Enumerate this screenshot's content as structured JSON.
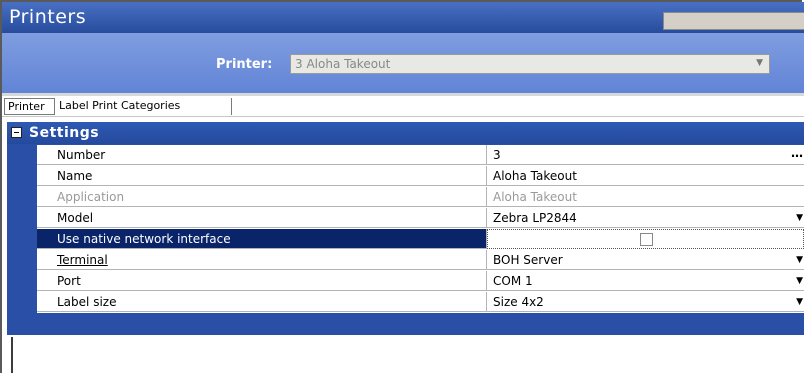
{
  "window": {
    "title": "Printers"
  },
  "selector": {
    "label": "Printer:",
    "value": "3  Aloha Takeout"
  },
  "tabs": [
    {
      "label": "Printer",
      "active": true
    },
    {
      "label": "Label Print Categories",
      "active": false
    }
  ],
  "section": {
    "title": "Settings",
    "expanded": true
  },
  "properties": [
    {
      "name": "Number",
      "value": "3",
      "editor": "ellipsis"
    },
    {
      "name": "Name",
      "value": "Aloha Takeout"
    },
    {
      "name": "Application",
      "value": "Aloha Takeout",
      "disabled": true
    },
    {
      "name": "Model",
      "value": "Zebra LP2844",
      "editor": "dropdown"
    },
    {
      "name": "Use native network interface",
      "value": "",
      "editor": "checkbox",
      "checked": false,
      "selected": true
    },
    {
      "name": "Terminal",
      "value": "BOH Server",
      "editor": "dropdown",
      "underlined": true
    },
    {
      "name": "Port",
      "value": "COM 1",
      "editor": "dropdown"
    },
    {
      "name": "Label size",
      "value": "Size 4x2",
      "editor": "dropdown"
    }
  ],
  "colors": {
    "title_bar": "#274c9c",
    "selector_bar": "#6284d6",
    "selection": "#0a246a"
  }
}
